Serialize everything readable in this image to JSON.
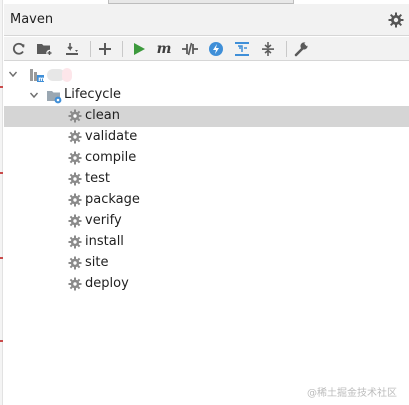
{
  "panel": {
    "title": "Maven"
  },
  "toolbar": {
    "buttons": [
      {
        "name": "reload-all-projects",
        "icon": "refresh-icon"
      },
      {
        "name": "generate-sources",
        "icon": "folder-plus-icon"
      },
      {
        "name": "download-sources",
        "icon": "download-icon"
      },
      {
        "name": "add-maven-project",
        "icon": "plus-icon"
      },
      {
        "name": "run-maven-build",
        "icon": "play-icon"
      },
      {
        "name": "execute-maven-goal",
        "icon": "m-icon",
        "text": "m"
      },
      {
        "name": "toggle-offline-mode",
        "icon": "offline-icon"
      },
      {
        "name": "skip-tests",
        "icon": "lightning-icon"
      },
      {
        "name": "show-dependencies",
        "icon": "dependencies-icon"
      },
      {
        "name": "collapse-all",
        "icon": "collapse-icon"
      },
      {
        "name": "maven-settings",
        "icon": "wrench-icon"
      }
    ]
  },
  "tree": {
    "lifecycle_label": "Lifecycle",
    "goals": [
      "clean",
      "validate",
      "compile",
      "test",
      "package",
      "verify",
      "install",
      "site",
      "deploy"
    ],
    "selected": "clean"
  },
  "watermark": "@稀土掘金技术社区",
  "colors": {
    "toolbar_bg": "#f2f2f2",
    "selection_bg": "#d5d5d5",
    "run_green": "#3d9a3d",
    "accent_blue": "#3f8fd8",
    "icon_gray": "#5a5a5a"
  }
}
